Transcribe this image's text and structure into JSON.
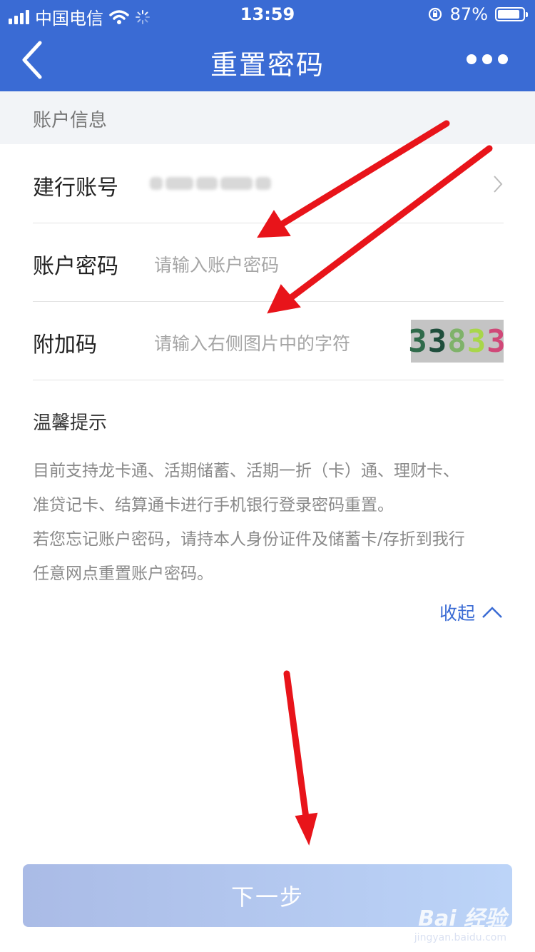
{
  "status_bar": {
    "carrier": "中国电信",
    "time": "13:59",
    "battery_percent": "87%",
    "battery_level": 0.87,
    "icons": [
      "signal-icon",
      "wifi-icon",
      "loading-icon",
      "rotation-lock-icon",
      "battery-icon"
    ]
  },
  "nav": {
    "title": "重置密码",
    "back_icon": "chevron-left-icon",
    "more_icon": "more-dots-icon"
  },
  "section": {
    "header": "账户信息"
  },
  "form": {
    "account": {
      "label": "建行账号"
    },
    "password": {
      "label": "账户密码",
      "placeholder": "请输入账户密码"
    },
    "captcha": {
      "label": "附加码",
      "placeholder": "请输入右侧图片中的字符",
      "chars": [
        {
          "char": "3",
          "color": "#2f6a4a"
        },
        {
          "char": "3",
          "color": "#1f4e3c"
        },
        {
          "char": "8",
          "color": "#7fb26a"
        },
        {
          "char": "3",
          "color": "#a8d64a"
        },
        {
          "char": "3",
          "color": "#d04878"
        }
      ]
    }
  },
  "tips": {
    "title": "温馨提示",
    "lines": [
      "目前支持龙卡通、活期储蓄、活期一折（卡）通、理财卡、",
      "准贷记卡、结算通卡进行手机银行登录密码重置。",
      "若您忘记账户密码，请持本人身份证件及储蓄卡/存折到我行",
      "任意网点重置账户密码。"
    ],
    "collapse_label": "收起"
  },
  "next_button": {
    "label": "下一步"
  },
  "watermark": {
    "logo": "Bai 经验",
    "url": "jingyan.baidu.com"
  },
  "colors": {
    "primary": "#3a6bd4",
    "annotation_arrow": "#e8141a",
    "button_gradient_start": "#aabbe6",
    "button_gradient_end": "#bcd4f8"
  }
}
